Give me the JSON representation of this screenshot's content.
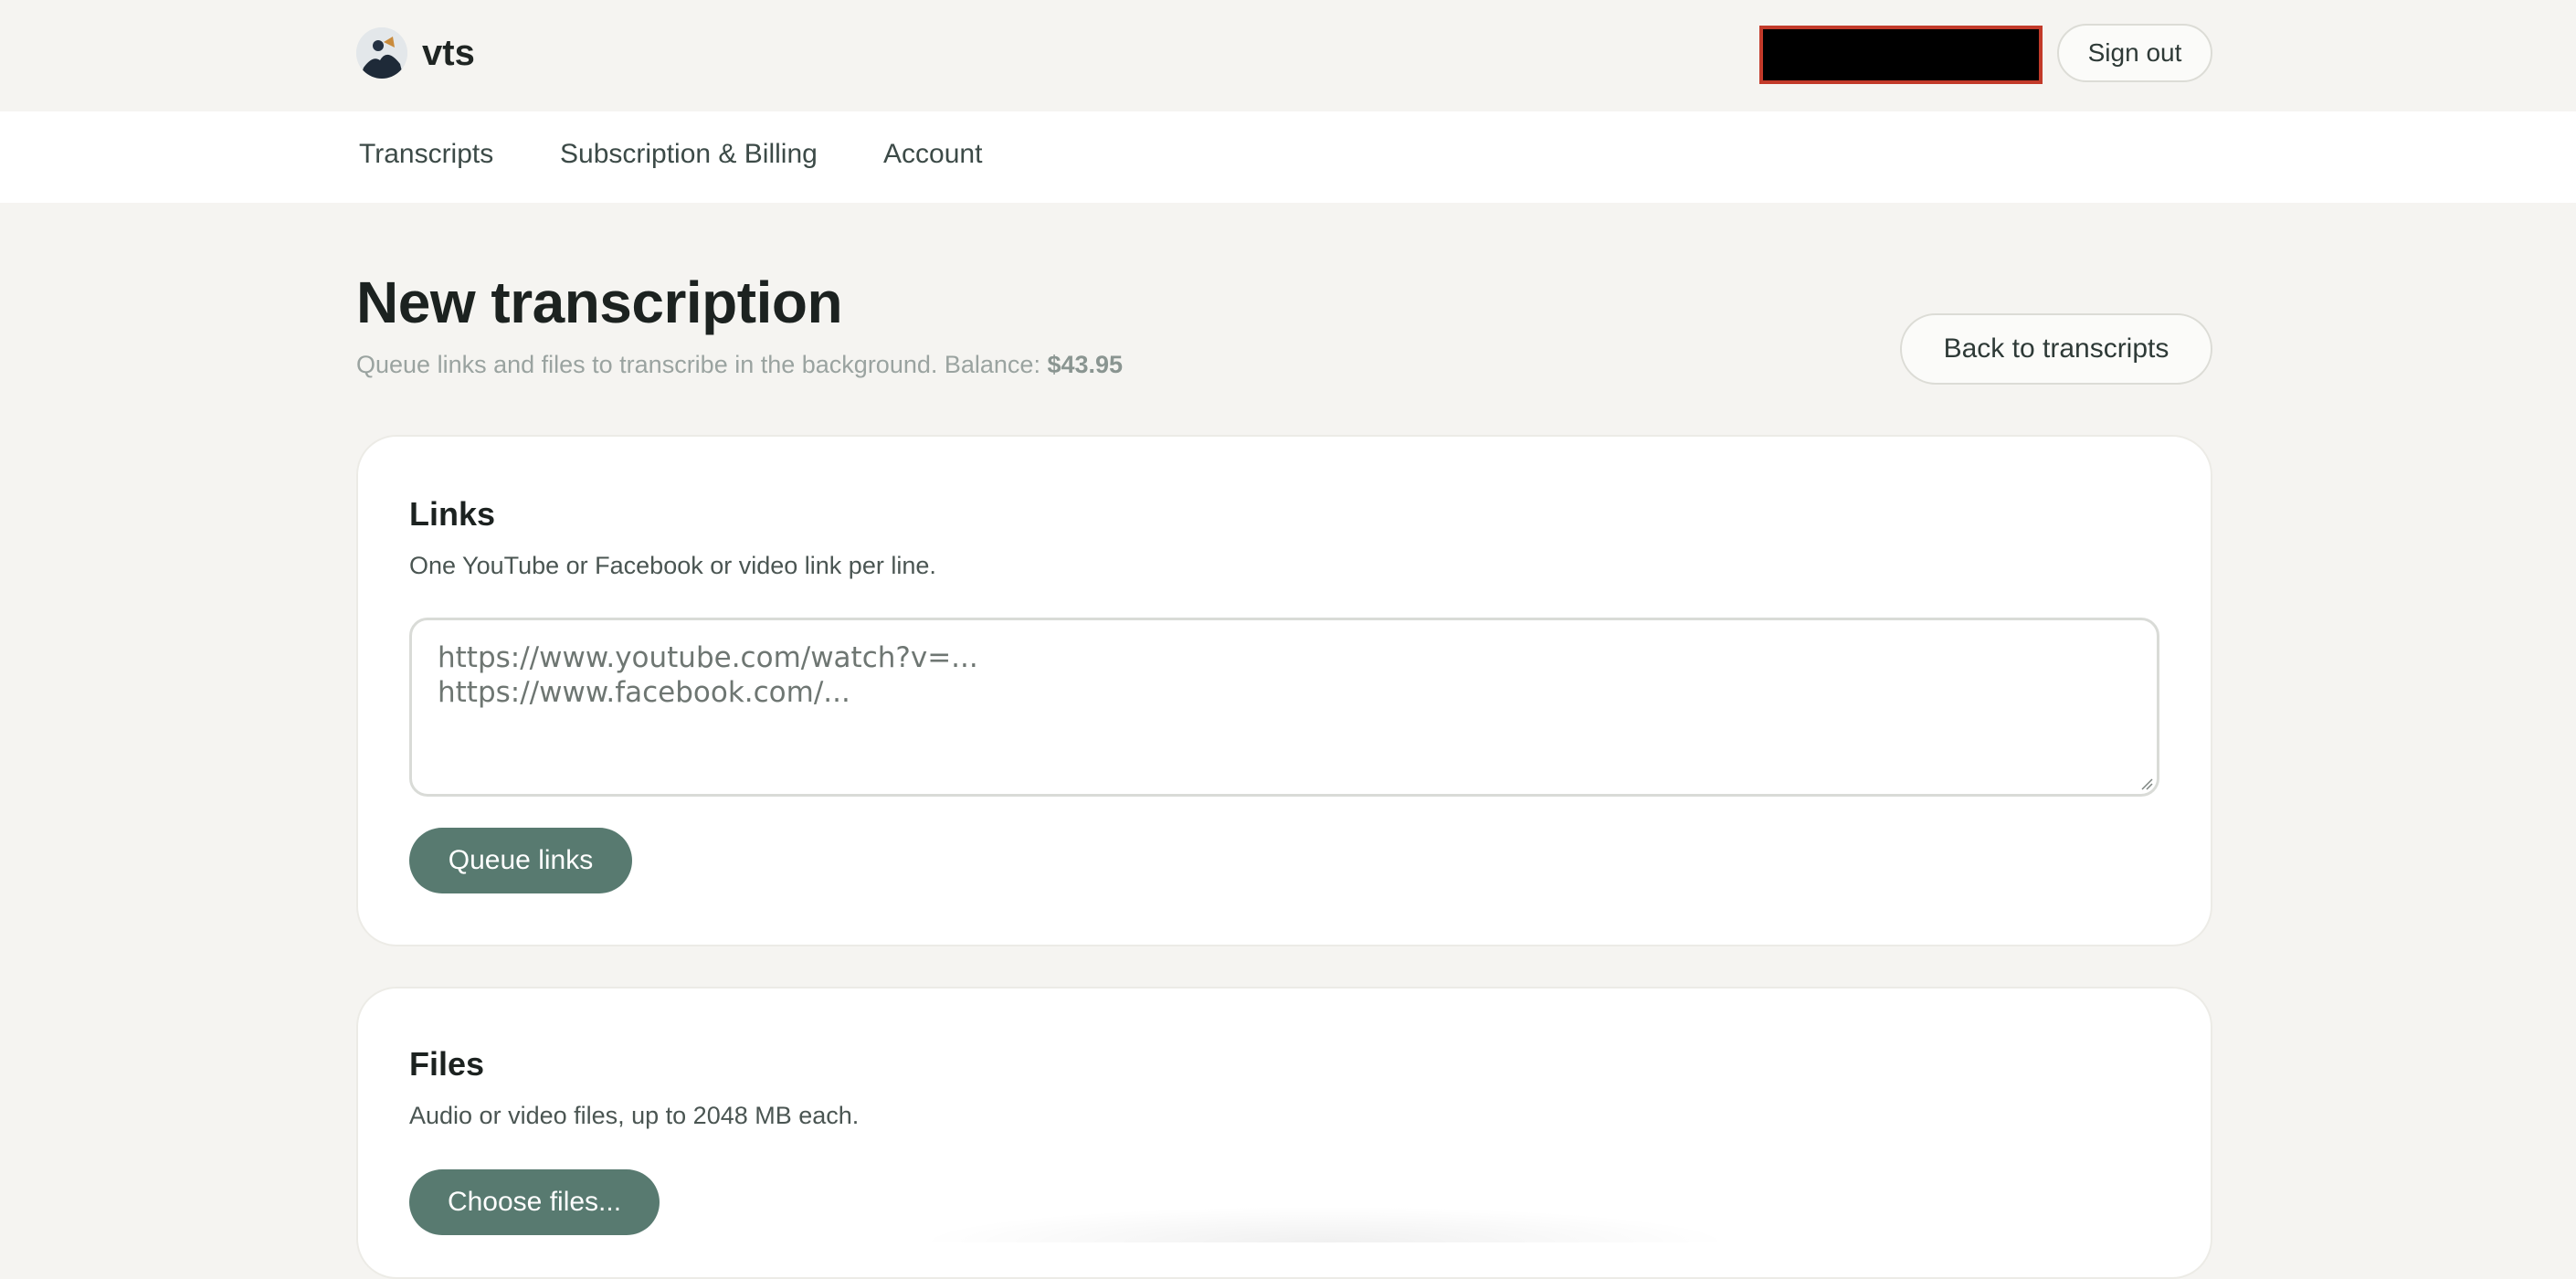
{
  "header": {
    "brand": "vts",
    "sign_out_label": "Sign out"
  },
  "nav": {
    "items": [
      {
        "label": "Transcripts"
      },
      {
        "label": "Subscription & Billing"
      },
      {
        "label": "Account"
      }
    ]
  },
  "page": {
    "title": "New transcription",
    "subtitle_prefix": "Queue links and files to transcribe in the background. Balance: ",
    "balance": "$43.95",
    "back_label": "Back to transcripts"
  },
  "links_card": {
    "title": "Links",
    "description": "One YouTube or Facebook or video link per line.",
    "placeholder_line1": "https://www.youtube.com/watch?v=...",
    "placeholder_line2": "https://www.facebook.com/...",
    "button_label": "Queue links"
  },
  "files_card": {
    "title": "Files",
    "description": "Audio or video files, up to 2048 MB each.",
    "button_label": "Choose files..."
  },
  "colors": {
    "accent": "#587a70",
    "background": "#f5f4f1",
    "redaction": "#000000",
    "redaction_border": "#c23a2a"
  }
}
